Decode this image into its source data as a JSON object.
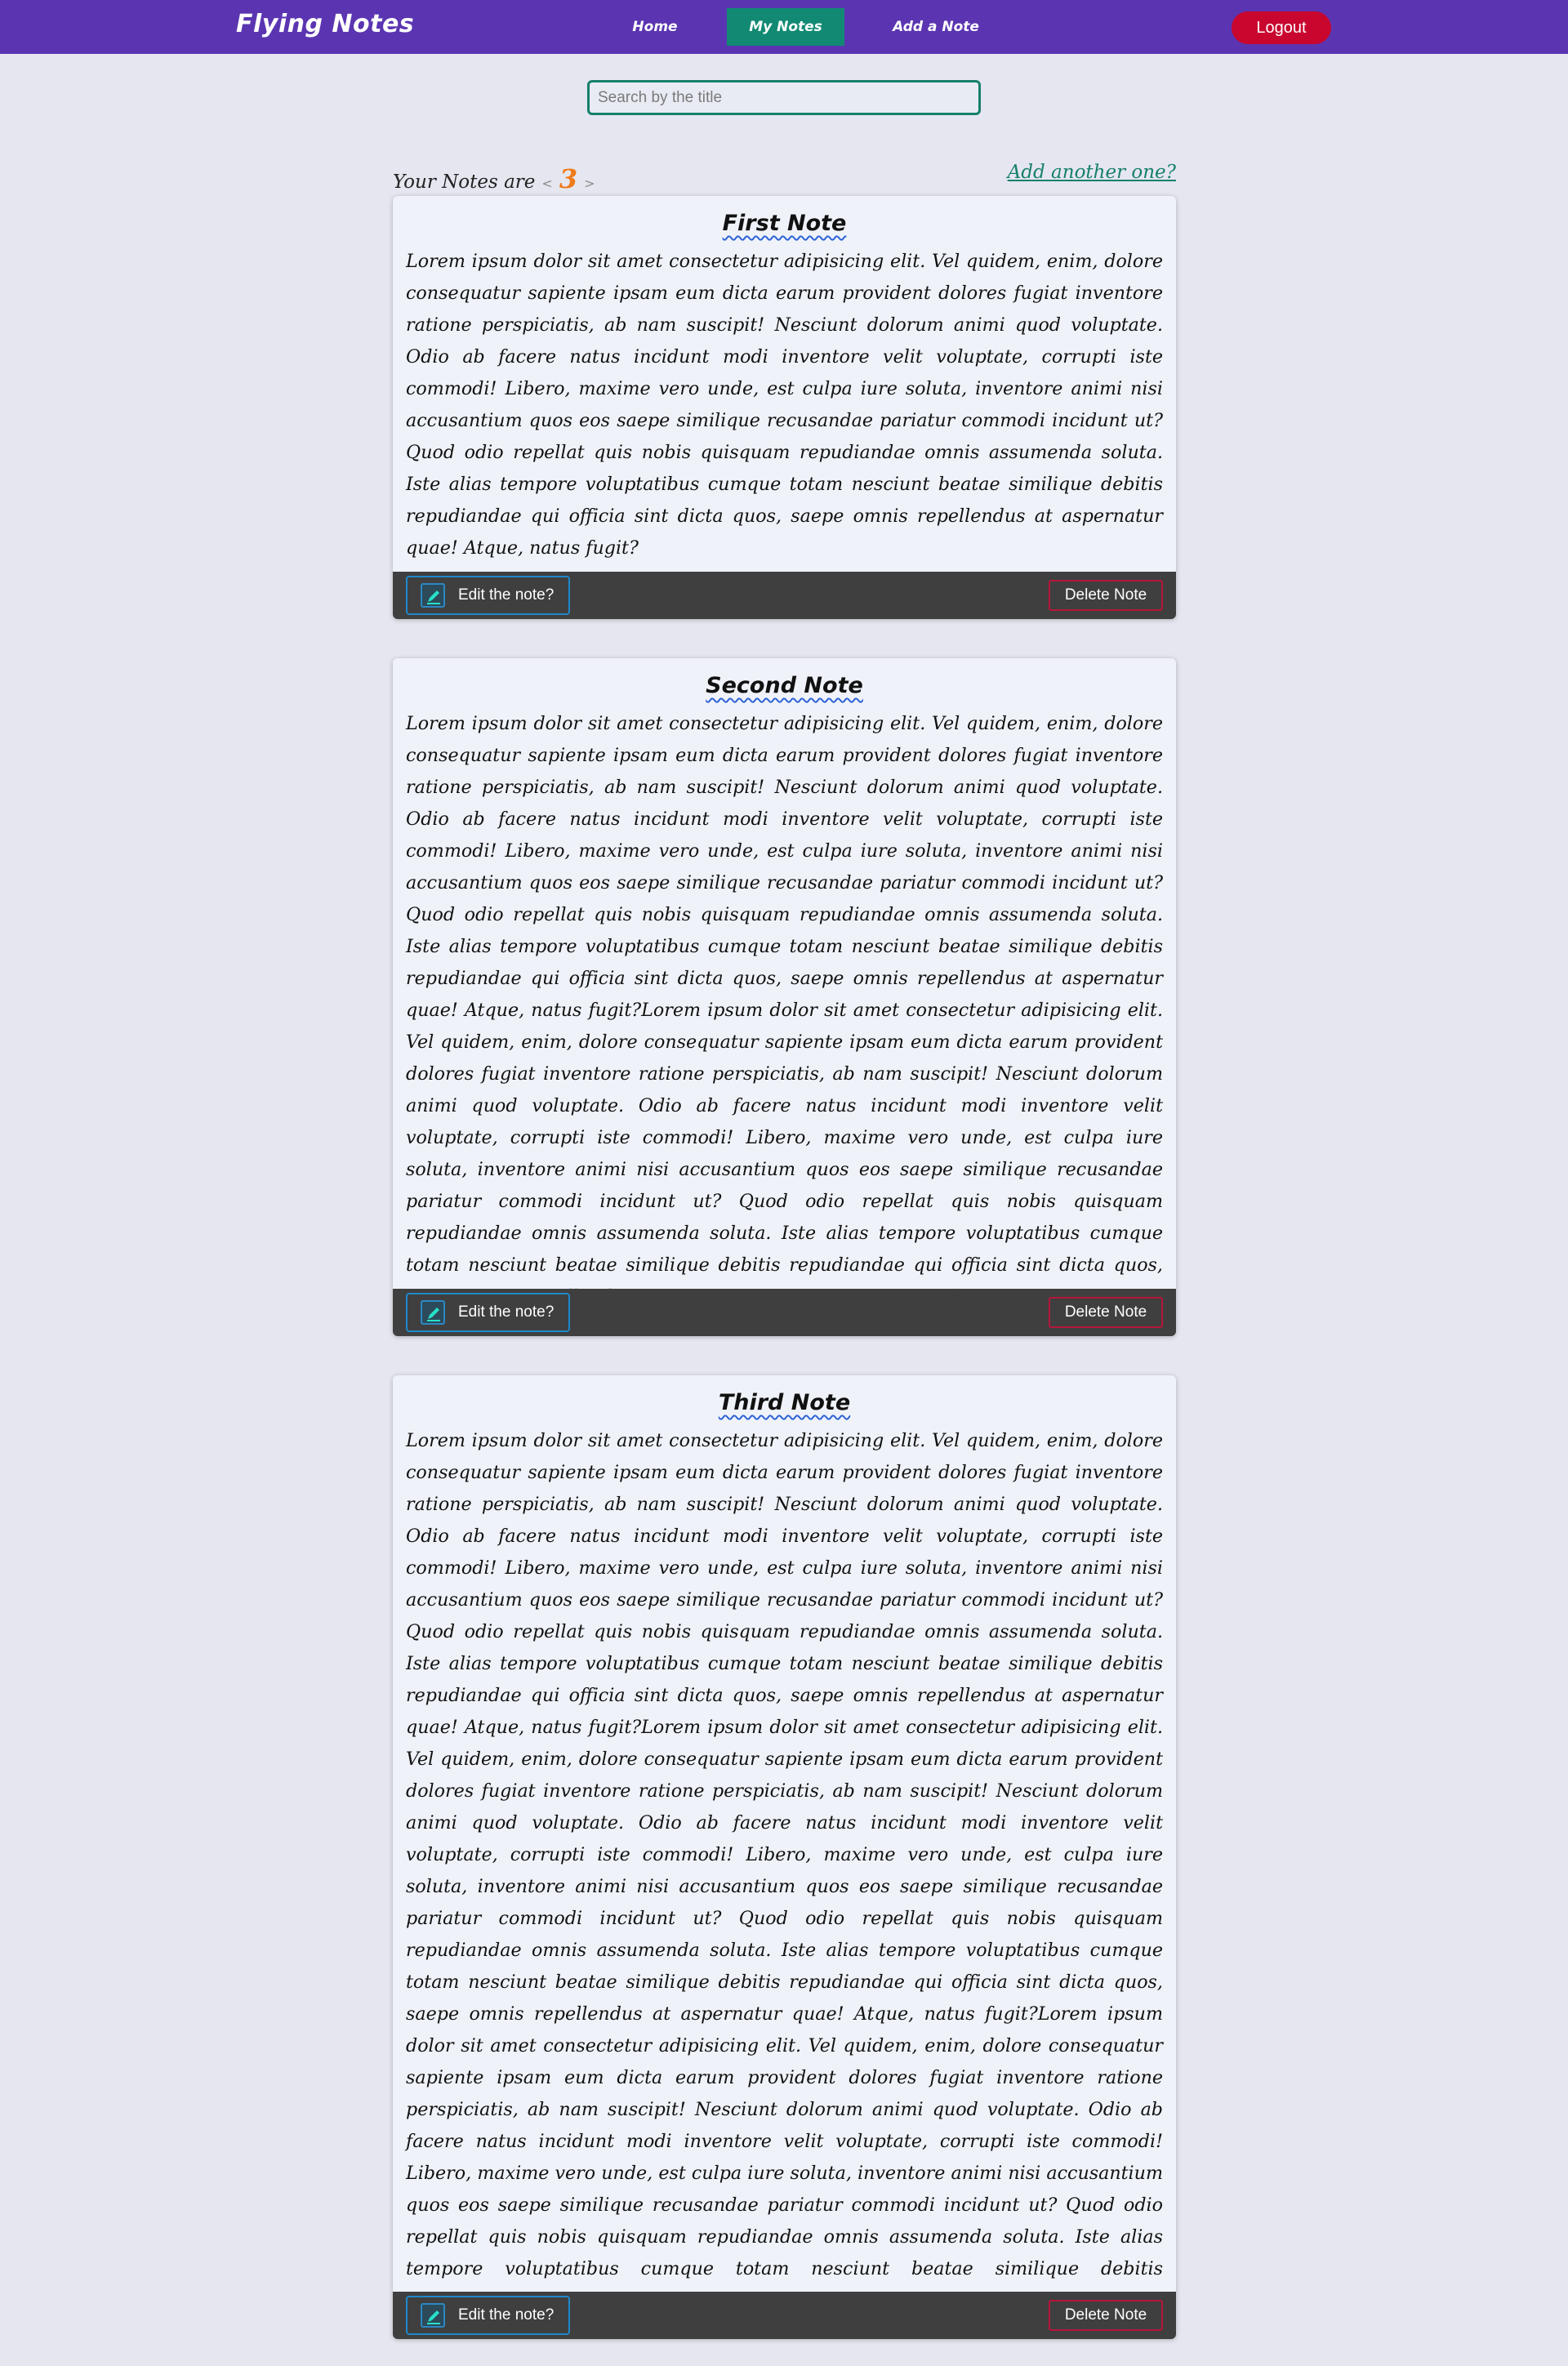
{
  "navbar": {
    "brand": "Flying Notes",
    "links": [
      "Home",
      "My Notes",
      "Add a Note"
    ],
    "logout_label": "Logout"
  },
  "search": {
    "placeholder": "Search by the title",
    "value": ""
  },
  "notes_header": {
    "prefix": "Your Notes are",
    "prev_arrow": "<",
    "count": "3",
    "next_arrow": ">",
    "add_link": "Add another one?"
  },
  "notes": [
    {
      "title": "First Note",
      "body": "Lorem ipsum dolor sit amet consectetur adipisicing elit. Vel quidem, enim, dolore consequatur sapiente ipsam eum dicta earum provident dolores fugiat inventore ratione perspiciatis, ab nam suscipit! Nesciunt dolorum animi quod voluptate. Odio ab facere natus incidunt modi inventore velit voluptate, corrupti iste commodi! Libero, maxime vero unde, est culpa iure soluta, inventore animi nisi accusantium quos eos saepe similique recusandae pariatur commodi incidunt ut? Quod odio repellat quis nobis quisquam repudiandae omnis assumenda soluta. Iste alias tempore voluptatibus cumque totam nesciunt beatae similique debitis repudiandae qui officia sint dicta quos, saepe omnis repellendus at aspernatur quae! Atque, natus fugit?",
      "edit_label": "Edit the note?",
      "delete_label": "Delete Note"
    },
    {
      "title": "Second Note",
      "body": "Lorem ipsum dolor sit amet consectetur adipisicing elit. Vel quidem, enim, dolore consequatur sapiente ipsam eum dicta earum provident dolores fugiat inventore ratione perspiciatis, ab nam suscipit! Nesciunt dolorum animi quod voluptate. Odio ab facere natus incidunt modi inventore velit voluptate, corrupti iste commodi! Libero, maxime vero unde, est culpa iure soluta, inventore animi nisi accusantium quos eos saepe similique recusandae pariatur commodi incidunt ut? Quod odio repellat quis nobis quisquam repudiandae omnis assumenda soluta. Iste alias tempore voluptatibus cumque totam nesciunt beatae similique debitis repudiandae qui officia sint dicta quos, saepe omnis repellendus at aspernatur quae! Atque, natus fugit?Lorem ipsum dolor sit amet consectetur adipisicing elit. Vel quidem, enim, dolore consequatur sapiente ipsam eum dicta earum provident dolores fugiat inventore ratione perspiciatis, ab nam suscipit! Nesciunt dolorum animi quod voluptate. Odio ab facere natus incidunt modi inventore velit voluptate, corrupti iste commodi! Libero, maxime vero unde, est culpa iure soluta, inventore animi nisi accusantium quos eos saepe similique recusandae pariatur commodi incidunt ut? Quod odio repellat quis nobis quisquam repudiandae omnis assumenda soluta. Iste alias tempore voluptatibus cumque totam nesciunt beatae similique debitis repudiandae qui officia sint dicta quos, saepe omnis repellendus at aspernatur quae! Atque, natus fugit?",
      "edit_label": "Edit the note?",
      "delete_label": "Delete Note"
    },
    {
      "title": "Third Note",
      "body": "Lorem ipsum dolor sit amet consectetur adipisicing elit. Vel quidem, enim, dolore consequatur sapiente ipsam eum dicta earum provident dolores fugiat inventore ratione perspiciatis, ab nam suscipit! Nesciunt dolorum animi quod voluptate. Odio ab facere natus incidunt modi inventore velit voluptate, corrupti iste commodi! Libero, maxime vero unde, est culpa iure soluta, inventore animi nisi accusantium quos eos saepe similique recusandae pariatur commodi incidunt ut? Quod odio repellat quis nobis quisquam repudiandae omnis assumenda soluta. Iste alias tempore voluptatibus cumque totam nesciunt beatae similique debitis repudiandae qui officia sint dicta quos, saepe omnis repellendus at aspernatur quae! Atque, natus fugit?Lorem ipsum dolor sit amet consectetur adipisicing elit. Vel quidem, enim, dolore consequatur sapiente ipsam eum dicta earum provident dolores fugiat inventore ratione perspiciatis, ab nam suscipit! Nesciunt dolorum animi quod voluptate. Odio ab facere natus incidunt modi inventore velit voluptate, corrupti iste commodi! Libero, maxime vero unde, est culpa iure soluta, inventore animi nisi accusantium quos eos saepe similique recusandae pariatur commodi incidunt ut? Quod odio repellat quis nobis quisquam repudiandae omnis assumenda soluta. Iste alias tempore voluptatibus cumque totam nesciunt beatae similique debitis repudiandae qui officia sint dicta quos, saepe omnis repellendus at aspernatur quae! Atque, natus fugit?Lorem ipsum dolor sit amet consectetur adipisicing elit. Vel quidem, enim, dolore consequatur sapiente ipsam eum dicta earum provident dolores fugiat inventore ratione perspiciatis, ab nam suscipit! Nesciunt dolorum animi quod voluptate. Odio ab facere natus incidunt modi inventore velit voluptate, corrupti iste commodi! Libero, maxime vero unde, est culpa iure soluta, inventore animi nisi accusantium quos eos saepe similique recusandae pariatur commodi incidunt ut? Quod odio repellat quis nobis quisquam repudiandae omnis assumenda soluta. Iste alias tempore voluptatibus cumque totam nesciunt beatae similique debitis repudiandae qui officia sint dicta quos, saepe omnis repellendus at aspernatur quae! Atque, natus fugit?",
      "edit_label": "Edit the note?",
      "delete_label": "Delete Note"
    }
  ],
  "colors": {
    "navbar": "#5b35b1",
    "active_tab": "#128a73",
    "logout": "#c8062e",
    "count": "#ef7a1a",
    "link": "#16806a",
    "footer": "#3f3f40"
  }
}
